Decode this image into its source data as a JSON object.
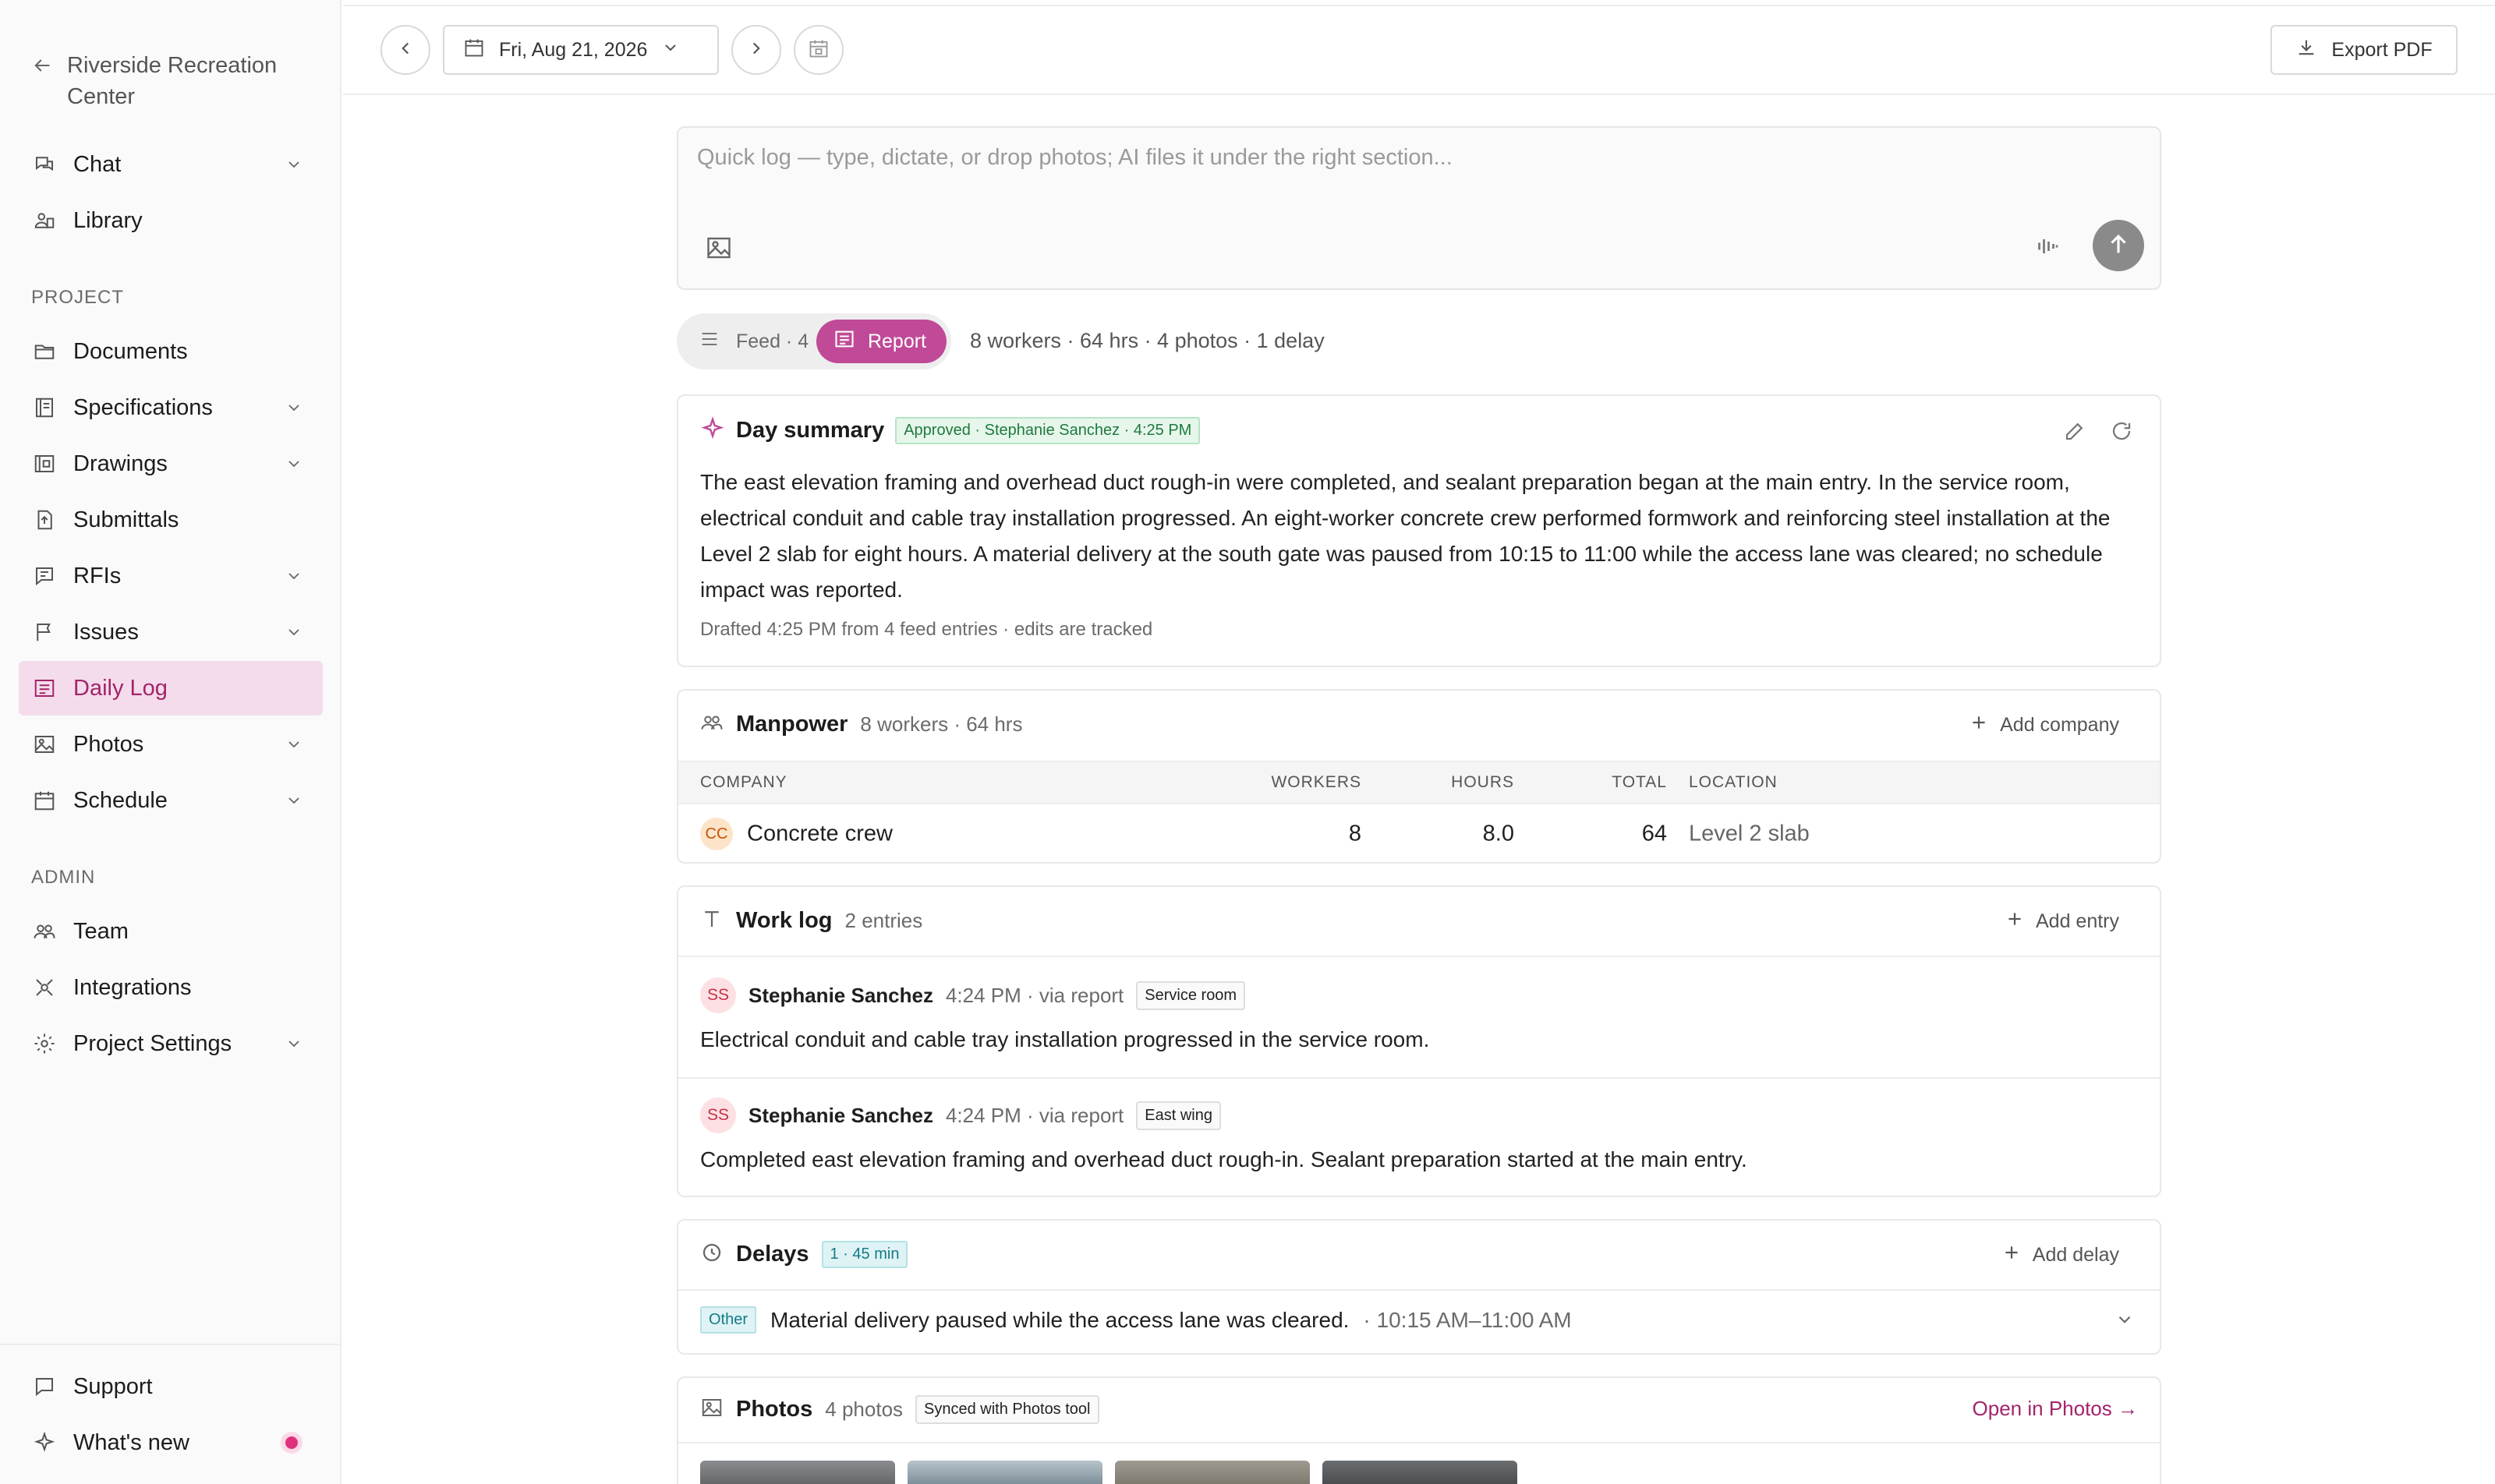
{
  "sidebar": {
    "project_name": "Riverside Recreation Center",
    "items_top": [
      {
        "label": "Chat"
      },
      {
        "label": "Library"
      }
    ],
    "section_project": "PROJECT",
    "items_project": [
      {
        "label": "Documents"
      },
      {
        "label": "Specifications"
      },
      {
        "label": "Drawings"
      },
      {
        "label": "Submittals"
      },
      {
        "label": "RFIs"
      },
      {
        "label": "Issues"
      },
      {
        "label": "Daily Log"
      },
      {
        "label": "Photos"
      },
      {
        "label": "Schedule"
      }
    ],
    "section_admin": "ADMIN",
    "items_admin": [
      {
        "label": "Team"
      },
      {
        "label": "Integrations"
      },
      {
        "label": "Project Settings"
      }
    ],
    "items_footer": [
      {
        "label": "Support"
      },
      {
        "label": "What's new"
      }
    ]
  },
  "topbar": {
    "date": "Fri, Aug 21, 2026",
    "export_label": "Export PDF"
  },
  "quicklog": {
    "placeholder": "Quick log — type, dictate, or drop photos; AI files it under the right section..."
  },
  "view_toggle": {
    "feed_label": "Feed · 4",
    "report_label": "Report",
    "meta": "8 workers · 64 hrs · 4 photos · 1 delay"
  },
  "summary": {
    "title": "Day summary",
    "badge": "Approved · Stephanie Sanchez · 4:25 PM",
    "body": "The east elevation framing and overhead duct rough-in were completed, and sealant preparation began at the main entry. In the service room, electrical conduit and cable tray installation progressed. An eight-worker concrete crew performed formwork and reinforcing steel installation at the Level 2 slab for eight hours. A material delivery at the south gate was paused from 10:15 to 11:00 while the access lane was cleared; no schedule impact was reported.",
    "footer": "Drafted 4:25 PM from 4 feed entries · edits are tracked"
  },
  "manpower": {
    "title": "Manpower",
    "meta": "8 workers · 64 hrs",
    "add_label": "Add company",
    "columns": {
      "company": "COMPANY",
      "workers": "WORKERS",
      "hours": "HOURS",
      "total": "TOTAL",
      "location": "LOCATION"
    },
    "rows": [
      {
        "initials": "CC",
        "company": "Concrete crew",
        "workers": "8",
        "hours": "8.0",
        "total": "64",
        "location": "Level 2 slab"
      }
    ]
  },
  "worklog": {
    "title": "Work log",
    "meta": "2 entries",
    "add_label": "Add entry",
    "entries": [
      {
        "initials": "SS",
        "author": "Stephanie Sanchez",
        "time": "4:24 PM · via report",
        "tag": "Service room",
        "text": "Electrical conduit and cable tray installation progressed in the service room."
      },
      {
        "initials": "SS",
        "author": "Stephanie Sanchez",
        "time": "4:24 PM · via report",
        "tag": "East wing",
        "text": "Completed east elevation framing and overhead duct rough-in. Sealant preparation started at the main entry."
      }
    ]
  },
  "delays": {
    "title": "Delays",
    "badge": "1 · 45 min",
    "add_label": "Add delay",
    "rows": [
      {
        "type": "Other",
        "text": "Material delivery paused while the access lane was cleared.",
        "time": "· 10:15 AM–11:00 AM"
      }
    ]
  },
  "photos": {
    "title": "Photos",
    "meta": "4 photos",
    "badge": "Synced with Photos tool",
    "open_label": "Open in Photos →"
  },
  "colors": {
    "accent": "#c04a97",
    "accent_text": "#a2246a",
    "active_nav_bg": "#f5dcec"
  }
}
